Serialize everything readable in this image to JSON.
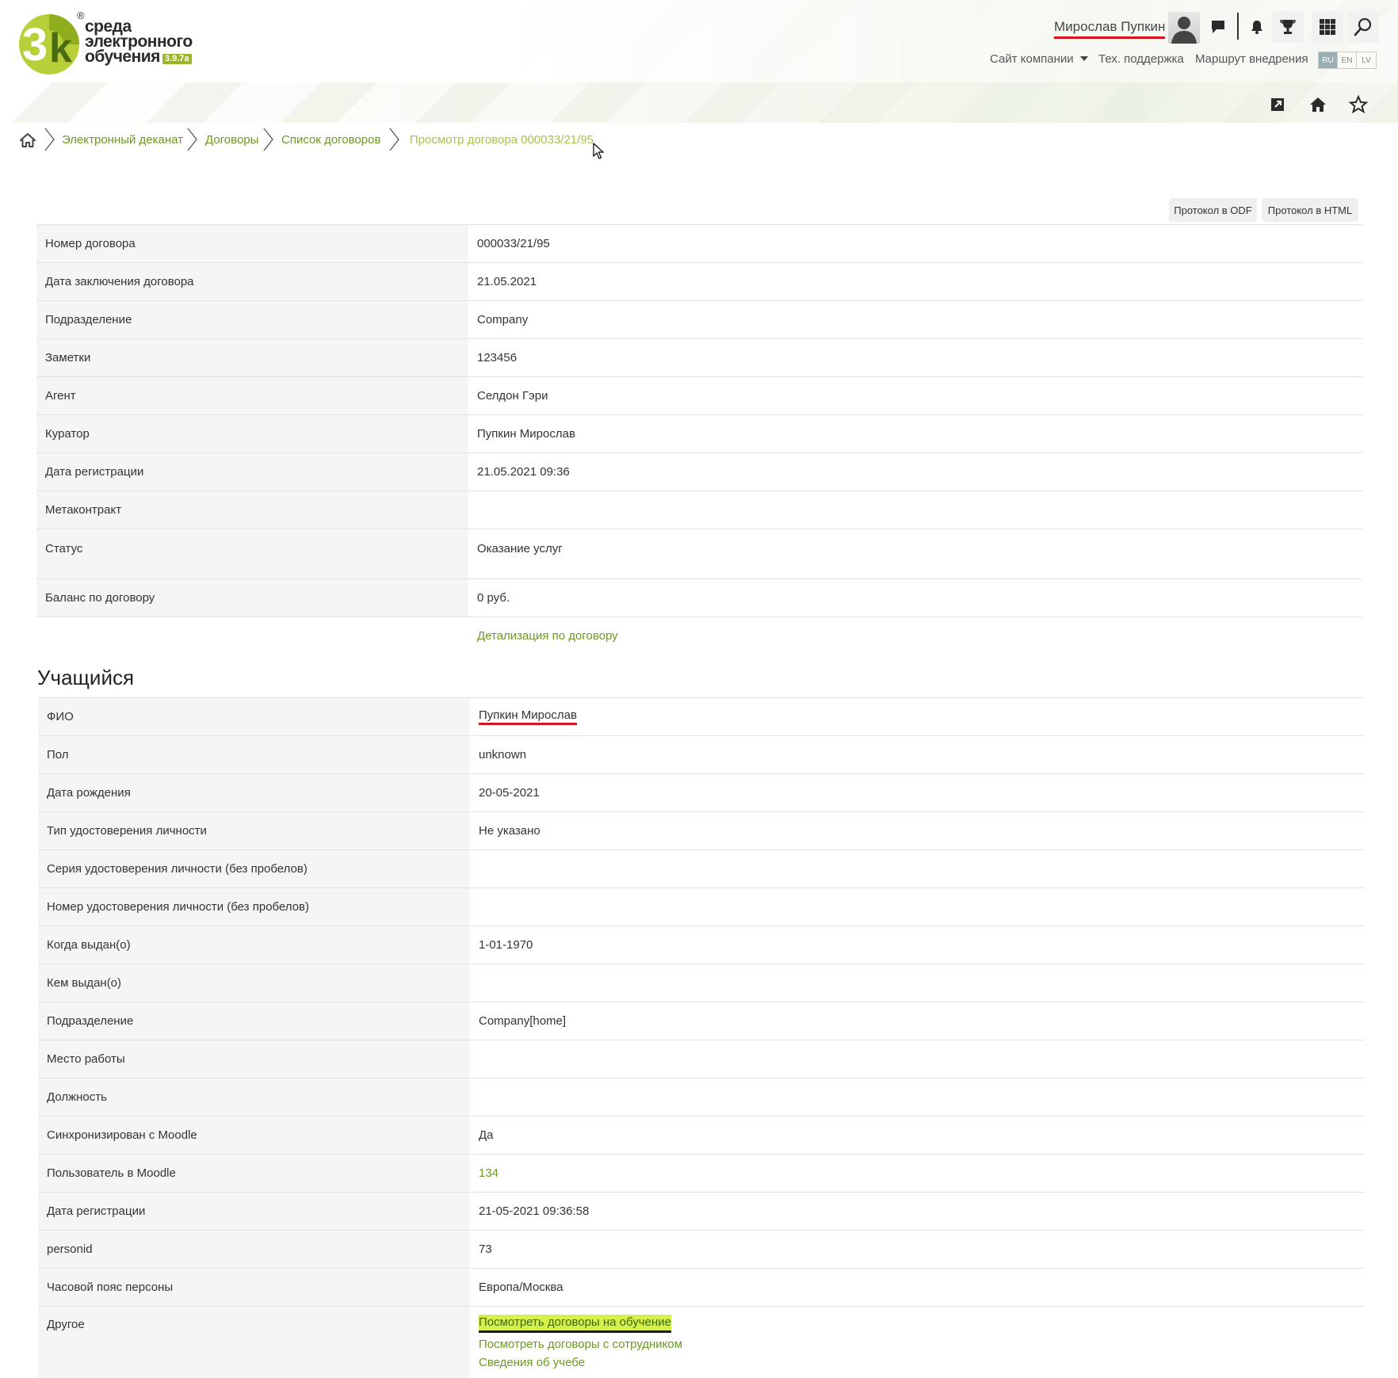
{
  "logo": {
    "line1": "среда",
    "line2": "электронного",
    "line3": "обучения",
    "version": "3.9.7a",
    "reg": "®"
  },
  "header": {
    "user_name": "Мирослав Пупкин",
    "nav": {
      "company_site": "Сайт компании",
      "support": "Тех. поддержка",
      "route": "Маршрут внедрения"
    },
    "languages": [
      "RU",
      "EN",
      "LV"
    ],
    "active_language": "RU"
  },
  "breadcrumb": {
    "items": [
      "Электронный деканат",
      "Договоры",
      "Список договоров",
      "Просмотр договора 000033/21/95"
    ]
  },
  "actions": {
    "protocol_odf": "Протокол в ODF",
    "protocol_html": "Протокол в HTML"
  },
  "contract": {
    "rows": [
      {
        "label": "Номер договора",
        "value": "000033/21/95"
      },
      {
        "label": "Дата заключения договора",
        "value": "21.05.2021"
      },
      {
        "label": "Подразделение",
        "value": "Company"
      },
      {
        "label": "Заметки",
        "value": "123456"
      },
      {
        "label": "Агент",
        "value": "Селдон Гэри"
      },
      {
        "label": "Куратор",
        "value": "Пупкин Мирослав"
      },
      {
        "label": "Дата регистрации",
        "value": "21.05.2021 09:36"
      },
      {
        "label": "Метаконтракт",
        "value": ""
      },
      {
        "label": "Статус",
        "value": "Оказание услуг"
      },
      {
        "label": "Баланс по договору",
        "value": "0 руб."
      }
    ],
    "details_link": "Детализация по договору"
  },
  "student": {
    "title": "Учащийся",
    "rows": [
      {
        "label": "ФИО",
        "value": "Пупкин Мирослав"
      },
      {
        "label": "Пол",
        "value": "unknown"
      },
      {
        "label": "Дата рождения",
        "value": "20-05-2021"
      },
      {
        "label": "Тип удостоверения личности",
        "value": "Не указано"
      },
      {
        "label": "Серия удостоверения личности (без пробелов)",
        "value": ""
      },
      {
        "label": "Номер удостоверения личности (без пробелов)",
        "value": ""
      },
      {
        "label": "Когда выдан(о)",
        "value": "1-01-1970"
      },
      {
        "label": "Кем выдан(о)",
        "value": ""
      },
      {
        "label": "Подразделение",
        "value": "Company[home]"
      },
      {
        "label": "Место работы",
        "value": ""
      },
      {
        "label": "Должность",
        "value": ""
      },
      {
        "label": "Синхронизирован с Moodle",
        "value": "Да"
      },
      {
        "label": "Пользователь в Moodle",
        "value": "134"
      },
      {
        "label": "Дата регистрации",
        "value": "21-05-2021 09:36:58"
      },
      {
        "label": "personid",
        "value": "73"
      },
      {
        "label": "Часовой пояс персоны",
        "value": "Европа/Москва"
      }
    ],
    "other_label": "Другое",
    "other_links": [
      "Посмотреть договоры на обучение",
      "Посмотреть договоры с сотрудником",
      "Сведения об учебе"
    ]
  },
  "colors": {
    "accent_green": "#6a9a1f",
    "highlight": "#d5f04a",
    "underline_red": "#d6141c"
  }
}
